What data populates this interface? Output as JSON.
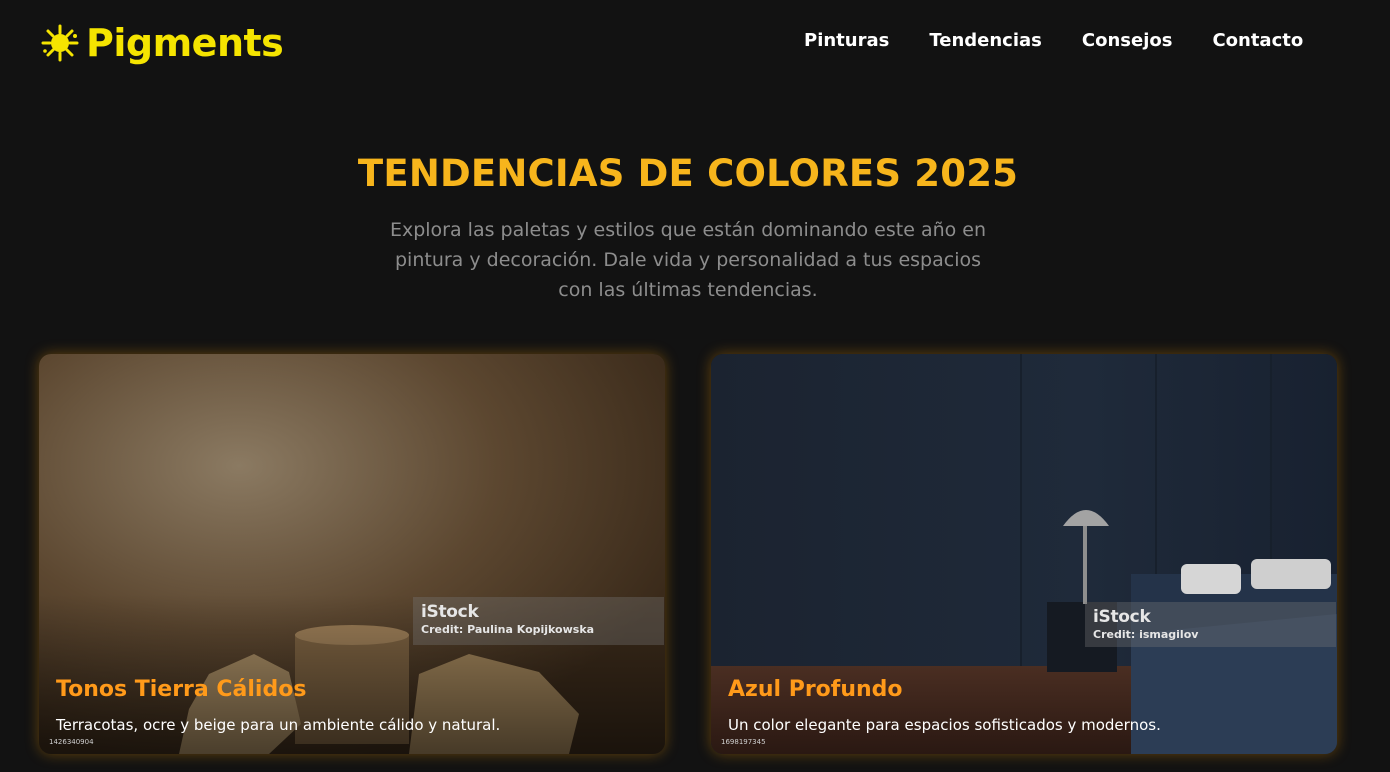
{
  "header": {
    "brand_name": "Pigments",
    "brand_icon": "paint-splash-icon",
    "nav": [
      "Pinturas",
      "Tendencias",
      "Consejos",
      "Contacto"
    ]
  },
  "hero": {
    "title": "TENDENCIAS DE COLORES 2025",
    "subtitle": "Explora las paletas y estilos que están dominando este año en pintura y decoración. Dale vida y personalidad a tus espacios con las últimas tendencias."
  },
  "cards": [
    {
      "title": "Tonos Tierra Cálidos",
      "description": "Terracotas, ocre y beige para un ambiente cálido y natural.",
      "watermark_logo": "iStock",
      "watermark_credit": "Credit: Paulina Kopijkowska",
      "image_id": "1426340904"
    },
    {
      "title": "Azul Profundo",
      "description": "Un color elegante para espacios sofisticados y modernos.",
      "watermark_logo": "iStock",
      "watermark_credit": "Credit: ismagilov",
      "image_id": "1698197345"
    }
  ],
  "colors": {
    "background": "#121212",
    "brand": "#f5e400",
    "hero_title": "#f7b51c",
    "card_title": "#ff9a1a"
  }
}
